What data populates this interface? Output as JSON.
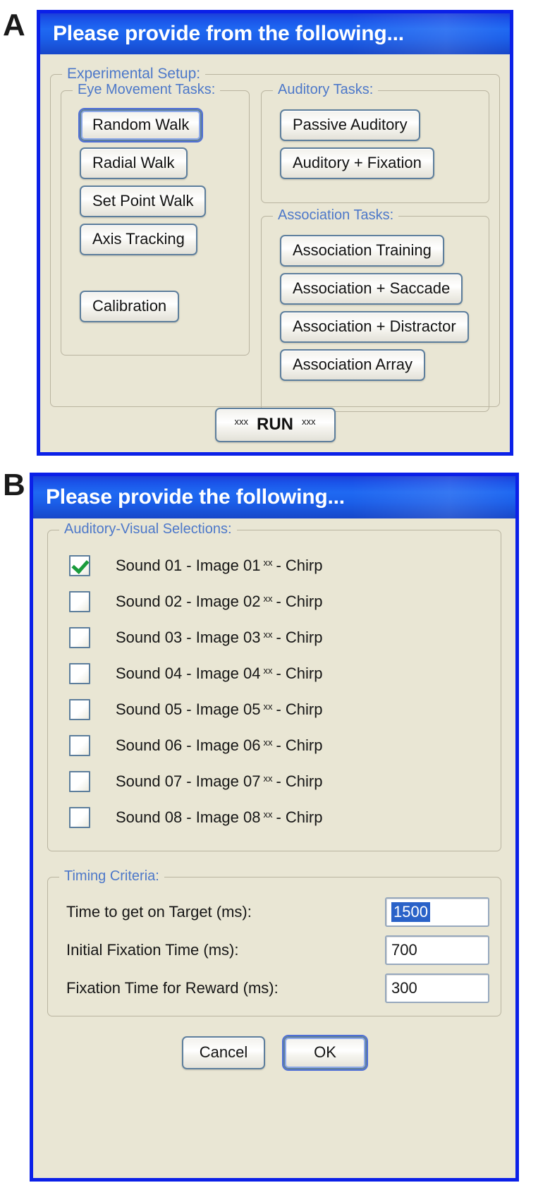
{
  "panels": {
    "a_letter": "A",
    "b_letter": "B"
  },
  "dialog_a": {
    "title": "Please provide from the following...",
    "experimental_setup": {
      "legend": "Experimental Setup:",
      "eye_movement": {
        "legend": "Eye Movement Tasks:",
        "buttons": [
          {
            "label": "Random Walk",
            "focused": true
          },
          {
            "label": "Radial Walk",
            "focused": false
          },
          {
            "label": "Set Point Walk",
            "focused": false
          },
          {
            "label": "Axis Tracking",
            "focused": false
          },
          {
            "label": "Calibration",
            "focused": false
          }
        ]
      },
      "auditory": {
        "legend": "Auditory Tasks:",
        "buttons": [
          {
            "label": "Passive Auditory"
          },
          {
            "label": "Auditory + Fixation"
          }
        ]
      },
      "association": {
        "legend": "Association Tasks:",
        "buttons": [
          {
            "label": "Association Training"
          },
          {
            "label": "Association + Saccade"
          },
          {
            "label": "Association + Distractor"
          },
          {
            "label": "Association Array"
          }
        ]
      }
    },
    "run": {
      "prefix": "xxx",
      "label": "RUN",
      "suffix": "xxx"
    }
  },
  "dialog_b": {
    "title": "Please provide the following...",
    "selections": {
      "legend": "Auditory-Visual Selections:",
      "rows": [
        {
          "checked": true,
          "text_before": "Sound 01 - Image 01",
          "sup": "xx",
          "text_after": "- Chirp"
        },
        {
          "checked": false,
          "text_before": "Sound 02 - Image 02",
          "sup": "xx",
          "text_after": "- Chirp"
        },
        {
          "checked": false,
          "text_before": "Sound 03 - Image 03",
          "sup": "xx",
          "text_after": "- Chirp"
        },
        {
          "checked": false,
          "text_before": "Sound 04 - Image 04",
          "sup": "xx",
          "text_after": "- Chirp"
        },
        {
          "checked": false,
          "text_before": "Sound 05 - Image 05",
          "sup": "xx",
          "text_after": "- Chirp"
        },
        {
          "checked": false,
          "text_before": "Sound 06 - Image 06",
          "sup": "xx",
          "text_after": "- Chirp"
        },
        {
          "checked": false,
          "text_before": "Sound 07 - Image 07",
          "sup": "xx",
          "text_after": "- Chirp"
        },
        {
          "checked": false,
          "text_before": "Sound 08 - Image 08",
          "sup": "xx",
          "text_after": "- Chirp"
        }
      ]
    },
    "timing": {
      "legend": "Timing Criteria:",
      "fields": [
        {
          "label": "Time to get on Target (ms):",
          "value": "1500",
          "selected": true
        },
        {
          "label": "Initial Fixation Time (ms):",
          "value": "700",
          "selected": false
        },
        {
          "label": "Fixation Time for Reward (ms):",
          "value": "300",
          "selected": false
        }
      ]
    },
    "footer": {
      "cancel_label": "Cancel",
      "ok_label": "OK",
      "ok_focused": true
    }
  },
  "colors": {
    "titlebar_blue": "#1f69f2",
    "window_border_blue": "#0b20e8",
    "dialog_face": "#e9e6d4",
    "legend_blue": "#4d78c9",
    "button_border": "#5d7e9c",
    "check_green": "#1a9b3c",
    "selection_blue": "#2a62c8"
  }
}
